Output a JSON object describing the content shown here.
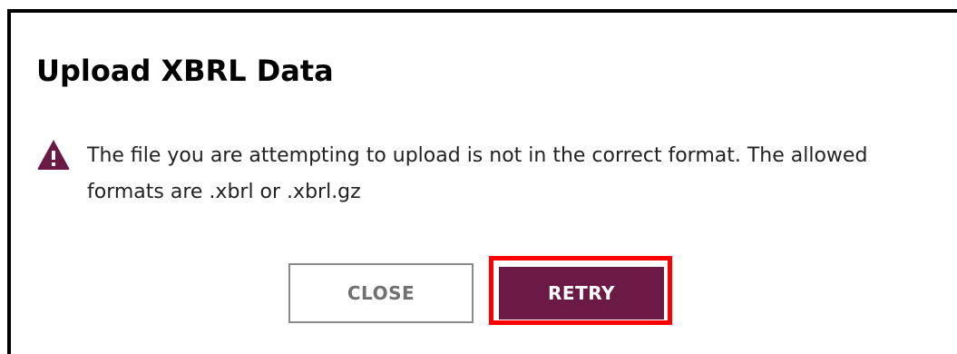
{
  "dialog": {
    "title": "Upload XBRL Data",
    "message": "The file you are attempting to upload is not in the correct format. The allowed formats are .xbrl or .xbrl.gz",
    "icon": "warning-triangle-icon",
    "buttons": {
      "close_label": "CLOSE",
      "retry_label": "RETRY"
    }
  },
  "colors": {
    "accent": "#6b1a45",
    "highlight": "#ff0000",
    "close_text": "#707070"
  }
}
